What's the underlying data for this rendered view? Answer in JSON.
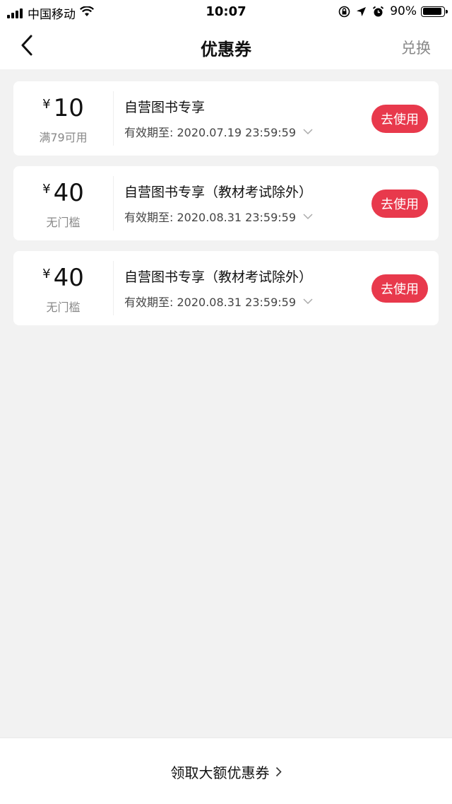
{
  "status_bar": {
    "carrier": "中国移动",
    "time": "10:07",
    "battery_percent": "90%",
    "battery_level": 0.9
  },
  "nav": {
    "title": "优惠券",
    "right_action": "兑换"
  },
  "coupons": [
    {
      "currency": "¥",
      "amount": "10",
      "condition": "满79可用",
      "title": "自营图书专享",
      "expiry": "有效期至: 2020.07.19 23:59:59",
      "button": "去使用"
    },
    {
      "currency": "¥",
      "amount": "40",
      "condition": "无门槛",
      "title": "自营图书专享（教材考试除外）",
      "expiry": "有效期至: 2020.08.31 23:59:59",
      "button": "去使用"
    },
    {
      "currency": "¥",
      "amount": "40",
      "condition": "无门槛",
      "title": "自营图书专享（教材考试除外）",
      "expiry": "有效期至: 2020.08.31 23:59:59",
      "button": "去使用"
    }
  ],
  "bottom": {
    "link_label": "领取大额优惠券"
  },
  "colors": {
    "accent": "#e8394c",
    "background": "#f2f2f2"
  },
  "icons": {
    "back": "chevron-left-icon",
    "expand": "chevron-down-icon",
    "more": "chevron-right-icon"
  }
}
